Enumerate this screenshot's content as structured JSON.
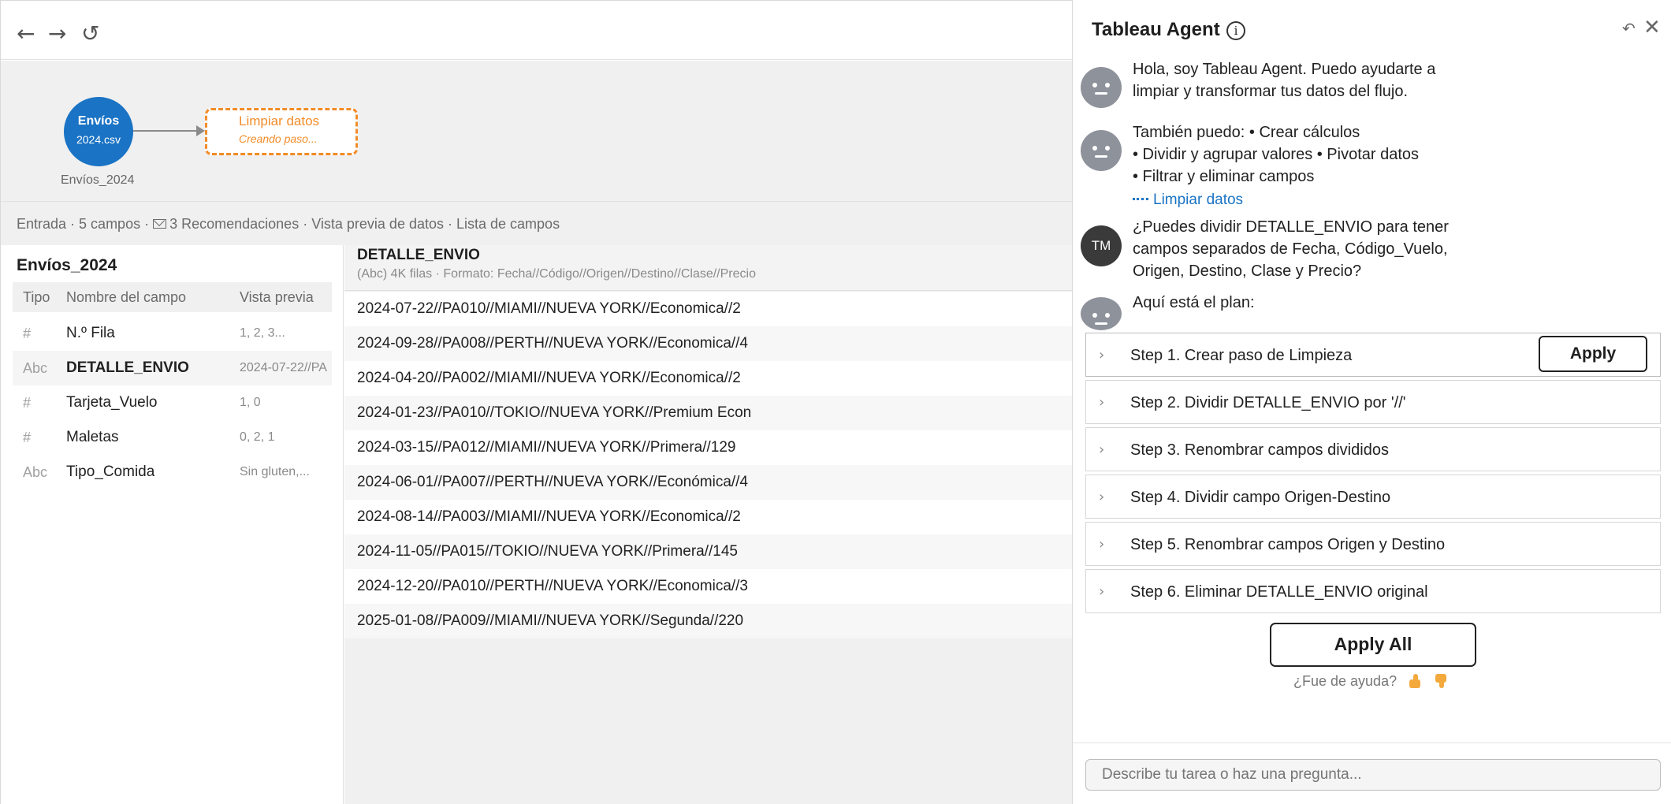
{
  "toolbar": {
    "back": "←",
    "forward": "→",
    "refresh": "↺"
  },
  "flow": {
    "input_node": {
      "line1": "Envíos",
      "line2": "2024.csv",
      "caption": "Envíos_2024",
      "color": "#1a73c4"
    },
    "clean_node": {
      "title": "Limpiar datos",
      "status": "Creando paso...",
      "color": "#f28c28"
    }
  },
  "summary": {
    "input": "Entrada · 5 campos ·",
    "recommendations": "3 Recomendaciones",
    "preview": "· Vista previa de datos ·",
    "fields": "Lista de campos"
  },
  "fields_panel": {
    "title": "Envíos_2024",
    "headers": {
      "type": "Tipo",
      "name": "Nombre del campo",
      "preview": "Vista previa"
    },
    "rows": [
      {
        "type": "#",
        "name": "N.º Fila",
        "preview": "1, 2, 3..."
      },
      {
        "type": "Abc",
        "name": "DETALLE_ENVIO",
        "preview": "2024-07-22//PA..."
      },
      {
        "type": "#",
        "name": "Tarjeta_Vuelo",
        "preview": "1, 0"
      },
      {
        "type": "#",
        "name": "Maletas",
        "preview": "0, 2, 1"
      },
      {
        "type": "Abc",
        "name": "Tipo_Comida",
        "preview": "Sin gluten,..."
      }
    ]
  },
  "data_preview": {
    "title": "DETALLE_ENVIO",
    "subtitle": "(Abc) 4K filas · Formato: Fecha//Código//Origen//Destino//Clase//Precio",
    "rows": [
      "2024-07-22//PA010//MIAMI//NUEVA YORK//Economica//2",
      "2024-09-28//PA008//PERTH//NUEVA YORK//Economica//4",
      "2024-04-20//PA002//MIAMI//NUEVA YORK//Economica//2",
      "2024-01-23//PA010//TOKIO//NUEVA YORK//Premium Econ",
      "2024-03-15//PA012//MIAMI//NUEVA YORK//Primera//129",
      "2024-06-01//PA007//PERTH//NUEVA YORK//Económica//4",
      "2024-08-14//PA003//MIAMI//NUEVA YORK//Economica//2",
      "2024-11-05//PA015//TOKIO//NUEVA YORK//Primera//145",
      "2024-12-20//PA010//PERTH//NUEVA YORK//Economica//3",
      "2025-01-08//PA009//MIAMI//NUEVA YORK//Segunda//220"
    ]
  },
  "agent": {
    "title": "Tableau Agent",
    "info_icon": "i",
    "undo_icon": "↶",
    "close_icon": "✕",
    "messages": [
      {
        "lines": [
          "Hola, soy Tableau Agent. Puedo ayudarte a",
          "limpiar y transformar tus datos del flujo."
        ]
      },
      {
        "lines": [
          "También puedo: • Crear cálculos",
          "• Dividir y agrupar valores • Pivotar datos",
          "• Filtrar y eliminar campos"
        ],
        "link": "Limpiar datos"
      },
      {
        "user_initials": "TM",
        "lines": [
          "¿Puedes dividir DETALLE_ENVIO para tener",
          "campos separados de Fecha, Código_Vuelo,",
          "Origen, Destino, Clase y Precio?"
        ]
      },
      {
        "lines": [
          "Aquí está el plan:"
        ]
      }
    ],
    "steps": [
      "Step 1. Crear paso de Limpieza",
      "Step 2. Dividir DETALLE_ENVIO por '//'",
      "Step 3. Renombrar campos divididos",
      "Step 4. Dividir campo Origen-Destino",
      "Step 5. Renombrar campos Origen y Destino",
      "Step 6. Eliminar DETALLE_ENVIO original"
    ],
    "apply_label": "Apply",
    "apply_all_label": "Apply All",
    "feedback": "¿Fue de ayuda?",
    "input_placeholder": "Describe tu tarea o haz una pregunta..."
  }
}
